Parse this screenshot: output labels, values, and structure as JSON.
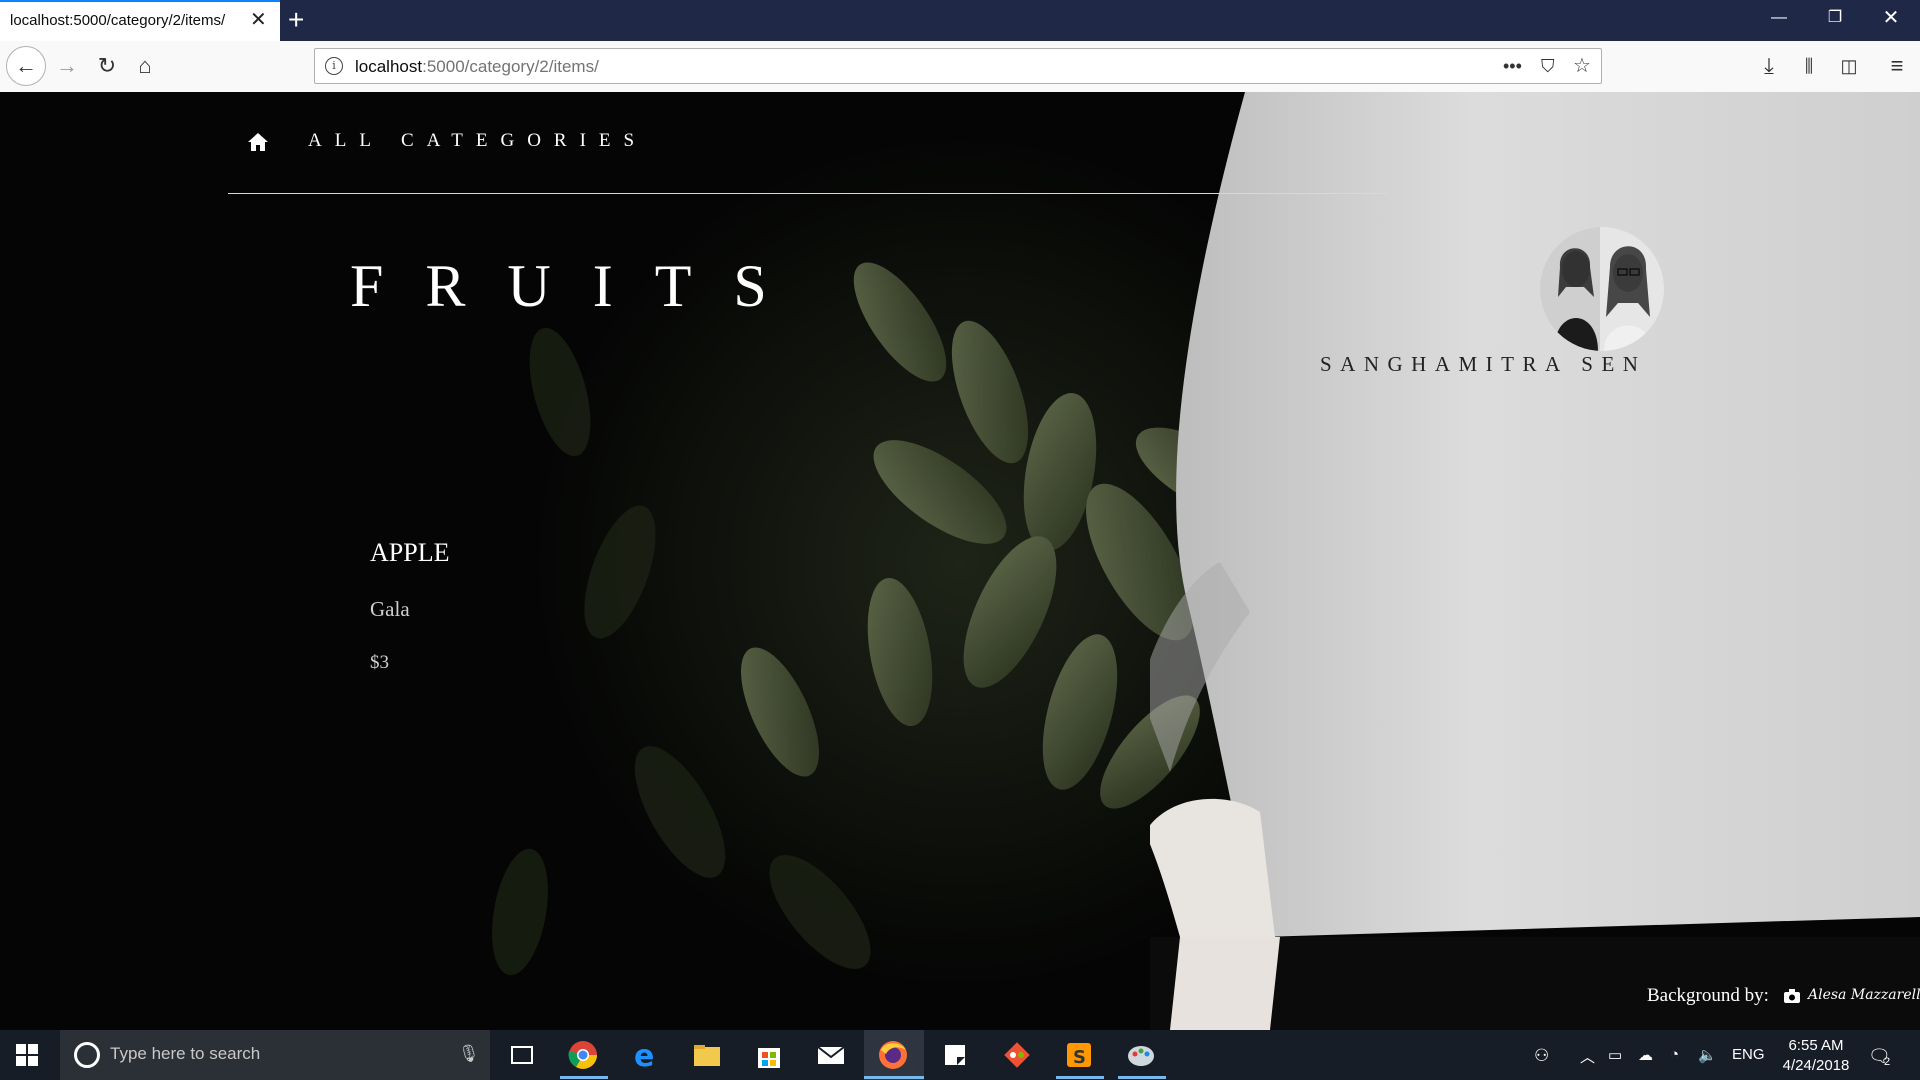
{
  "browser": {
    "tab_title": "localhost:5000/category/2/items/",
    "url_host": "localhost",
    "url_rest": ":5000/category/2/items/"
  },
  "page": {
    "nav_label": "ALL CATEGORIES",
    "category_title": "FRUITS",
    "item": {
      "name": "APPLE",
      "description": "Gala",
      "price": "$3"
    },
    "author": "SANGHAMITRA SEN",
    "credit_label": "Background by:",
    "credit_name": "Alesa Mazzarella"
  },
  "taskbar": {
    "search_placeholder": "Type here to search",
    "language": "ENG",
    "time": "6:55 AM",
    "date": "4/24/2018",
    "notification_count": "2"
  }
}
